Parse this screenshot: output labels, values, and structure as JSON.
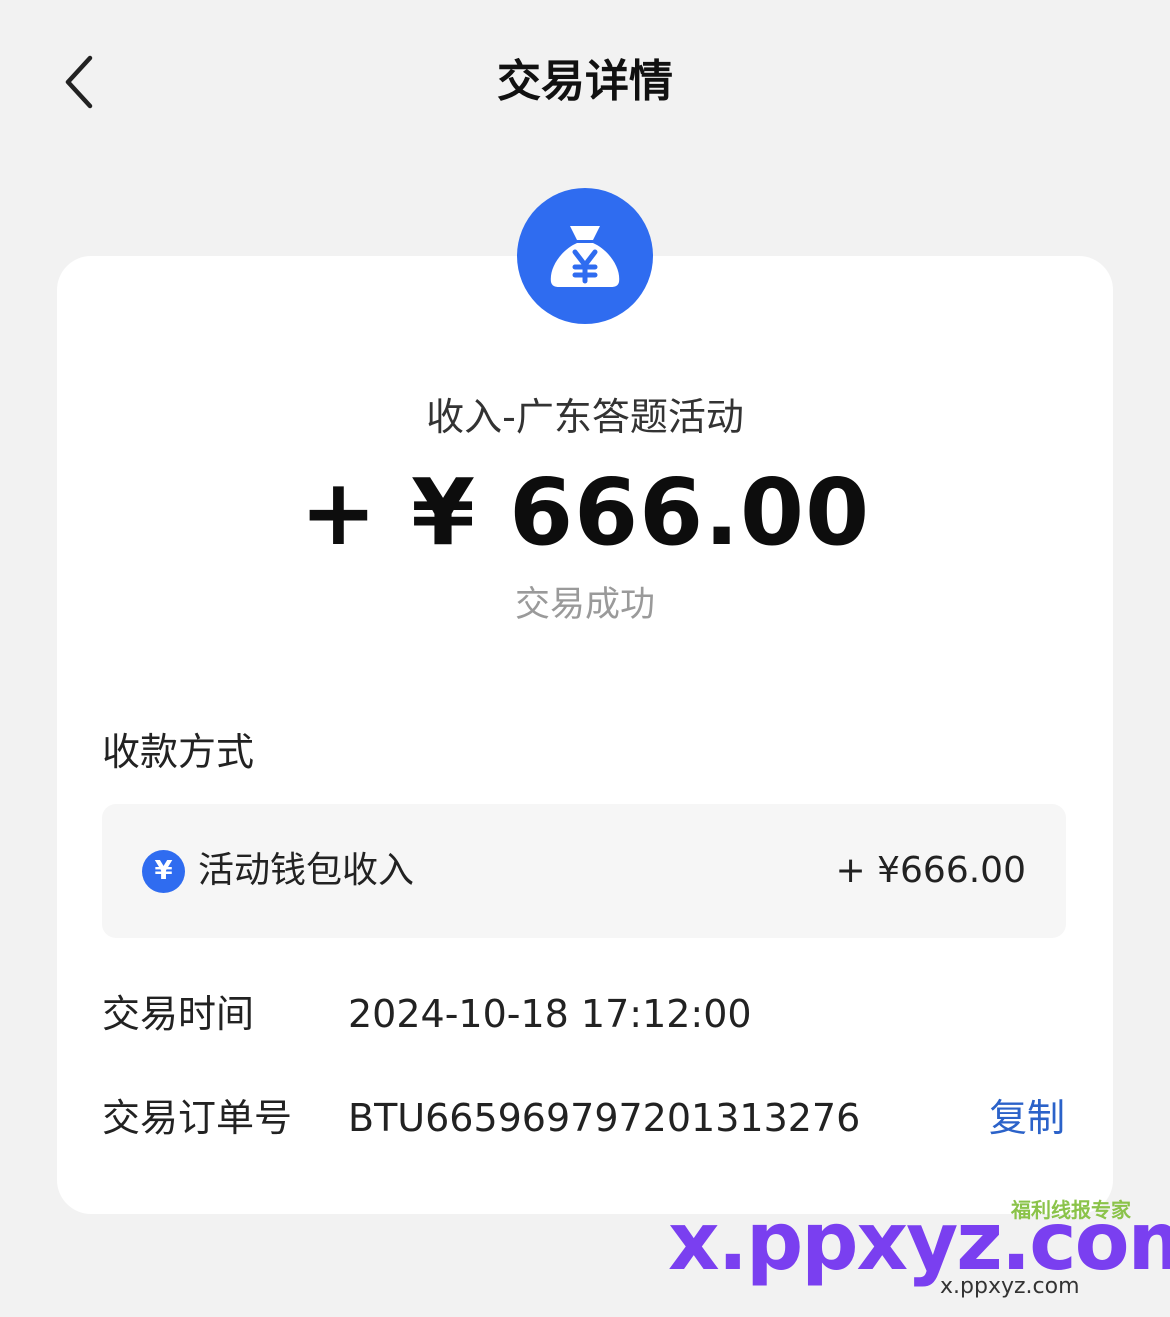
{
  "header": {
    "title": "交易详情",
    "back_icon": "chevron-left-icon"
  },
  "transaction": {
    "icon": "money-bag-yen-icon",
    "icon_color": "#2f6cf0",
    "description": "收入-广东答题活动",
    "amount": "+ ¥ 666.00",
    "status": "交易成功"
  },
  "payment_method": {
    "section_label": "收款方式",
    "icon": "yen-circle-icon",
    "name": "活动钱包收入",
    "amount": "+ ¥666.00"
  },
  "details": {
    "time_label": "交易时间",
    "time_value": "2024-10-18 17:12:00",
    "order_label": "交易订单号",
    "order_value": "BTU665969797201313276",
    "copy_label": "复制",
    "link_color": "#2b62c9"
  },
  "watermark": {
    "main": "x.ppxyz.com",
    "badge": "福利线报专家",
    "sub": "x.ppxyz.com"
  }
}
